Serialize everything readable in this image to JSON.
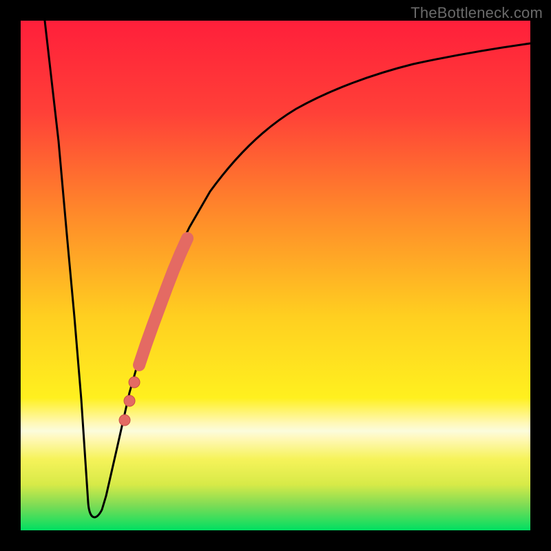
{
  "watermark": "TheBottleneck.com",
  "colors": {
    "frame": "#000000",
    "gradient_top": "#ff2940",
    "gradient_mid_upper": "#ff6a2f",
    "gradient_mid": "#ffd31f",
    "gradient_mid_lower": "#fff01f",
    "gradient_bottom": "#00e060",
    "white_band": "#fdfde0",
    "curve_stroke": "#000000",
    "marker_fill": "#e46a63",
    "marker_stroke": "#c94f49",
    "watermark": "#6a6a6a"
  },
  "chart_data": {
    "type": "line",
    "title": "",
    "xlabel": "",
    "ylabel": "",
    "xlim": [
      0,
      100
    ],
    "ylim": [
      0,
      100
    ],
    "grid": false,
    "series": [
      {
        "name": "bottleneck-curve",
        "x": [
          0,
          4,
          6,
          8,
          10,
          11.5,
          12.5,
          14,
          16,
          18,
          20,
          22,
          24,
          26,
          28,
          30,
          33,
          36,
          40,
          45,
          50,
          55,
          60,
          65,
          70,
          78,
          86,
          94,
          100
        ],
        "y": [
          100,
          65,
          45,
          27,
          10,
          2,
          2,
          3,
          9,
          18,
          27,
          35,
          42,
          49,
          55,
          60,
          67,
          72,
          77,
          82,
          86,
          89,
          91,
          93,
          94.5,
          96,
          97.2,
          98.2,
          99
        ]
      }
    ],
    "markers": {
      "name": "highlighted-points",
      "x": [
        22.0,
        22.8,
        23.6,
        24.4,
        25.2,
        26.0,
        26.8,
        27.6,
        28.4,
        29.2,
        26.5,
        25.0,
        23.8
      ],
      "y": [
        35.0,
        38.0,
        41.0,
        44.0,
        47.0,
        49.5,
        52.0,
        55.0,
        57.0,
        60.0,
        30.0,
        25.0,
        21.0
      ],
      "sizes": [
        9,
        9,
        10,
        10,
        10,
        10,
        10,
        10,
        10,
        9,
        7,
        7,
        7
      ]
    },
    "annotations": []
  }
}
